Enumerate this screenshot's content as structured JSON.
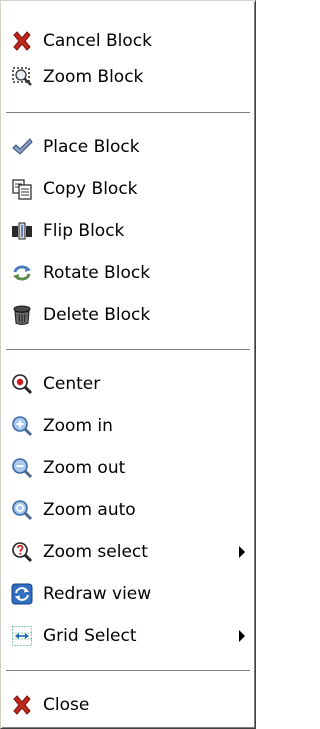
{
  "menu": {
    "items": [
      {
        "label": "Cancel Block",
        "icon": "red-x-icon"
      },
      {
        "label": "Zoom Block",
        "icon": "zoom-block-icon"
      },
      {
        "label": "Place Block",
        "icon": "checkmark-icon"
      },
      {
        "label": "Copy Block",
        "icon": "copy-icon"
      },
      {
        "label": "Flip Block",
        "icon": "flip-icon"
      },
      {
        "label": "Rotate Block",
        "icon": "rotate-icon"
      },
      {
        "label": "Delete Block",
        "icon": "trash-icon"
      },
      {
        "label": "Center",
        "icon": "center-magnifier-icon"
      },
      {
        "label": "Zoom in",
        "icon": "zoom-in-icon"
      },
      {
        "label": "Zoom out",
        "icon": "zoom-out-icon"
      },
      {
        "label": "Zoom auto",
        "icon": "zoom-auto-icon"
      },
      {
        "label": "Zoom select",
        "icon": "zoom-select-icon",
        "submenu": true
      },
      {
        "label": "Redraw view",
        "icon": "redraw-icon"
      },
      {
        "label": "Grid Select",
        "icon": "grid-select-icon",
        "submenu": true
      },
      {
        "label": "Close",
        "icon": "red-x-icon"
      }
    ]
  }
}
